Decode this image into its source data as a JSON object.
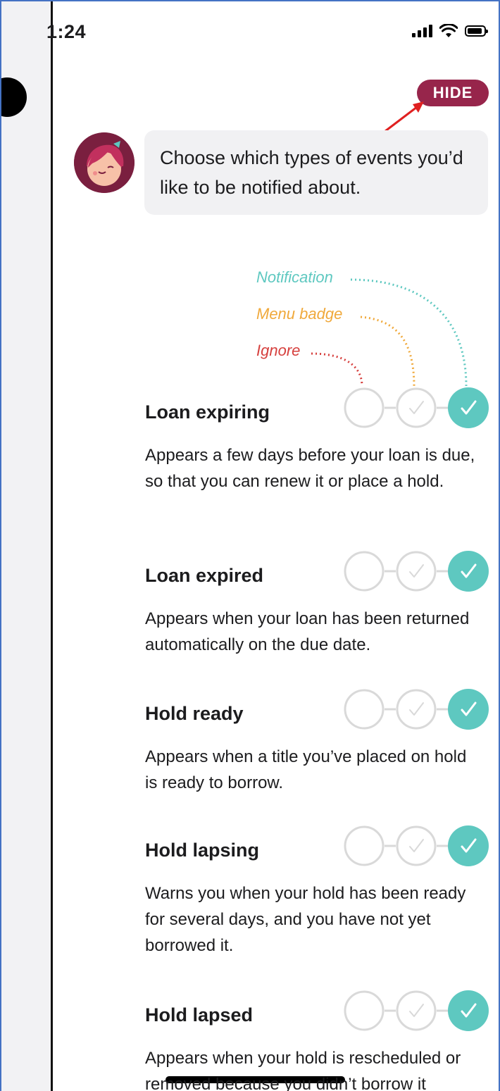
{
  "status_bar": {
    "time": "1:24"
  },
  "hide_button": {
    "label": "HIDE"
  },
  "intro": {
    "message": "Choose which types of events you’d like to be notified about."
  },
  "legend": {
    "notification": "Notification",
    "menu_badge": "Menu badge",
    "ignore": "Ignore"
  },
  "colors": {
    "accent": "#97254b",
    "notification": "#5ec8c0",
    "menu_badge": "#f0a93b",
    "ignore": "#d6403e",
    "selected_fill": "#5ec8c0",
    "unselected_border": "#d9d9d9"
  },
  "events": [
    {
      "title": "Loan expiring",
      "description": "Appears a few days before your loan is due, so that you can renew it or place a hold.",
      "selected": "notification"
    },
    {
      "title": "Loan expired",
      "description": "Appears when your loan has been returned automatically on the due date.",
      "selected": "notification"
    },
    {
      "title": "Hold ready",
      "description": "Appears when a title you’ve placed on hold is ready to borrow.",
      "selected": "notification"
    },
    {
      "title": "Hold lapsing",
      "description": "Warns you when your hold has been ready for several days, and you have not yet borrowed it.",
      "selected": "notification"
    },
    {
      "title": "Hold lapsed",
      "description": "Appears when your hold is rescheduled or removed because you didn’t borrow it",
      "selected": "notification"
    }
  ]
}
